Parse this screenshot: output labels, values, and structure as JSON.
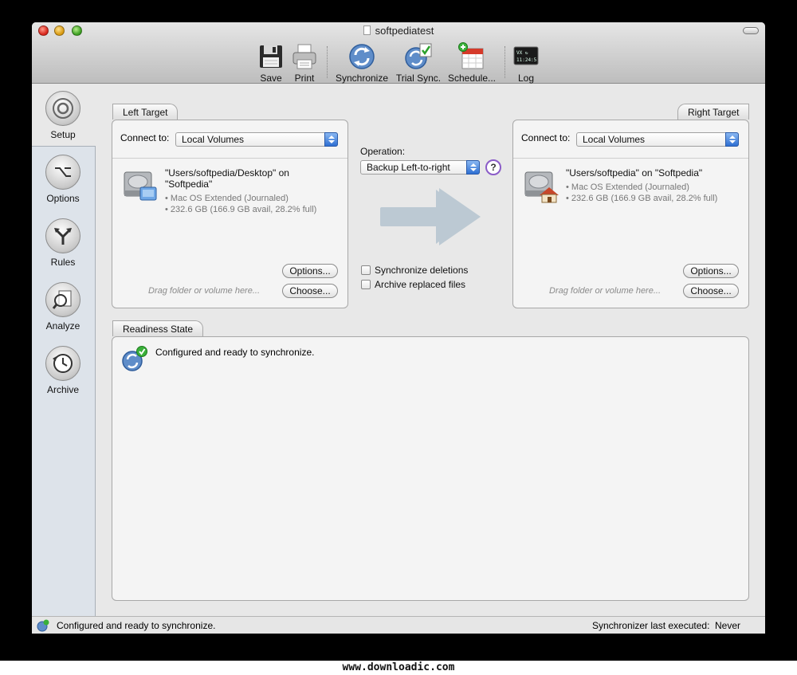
{
  "window": {
    "title": "softpediatest"
  },
  "toolbar": {
    "items": [
      {
        "label": "Save",
        "icon": "floppy-disk-icon"
      },
      {
        "label": "Print",
        "icon": "printer-icon"
      },
      {
        "label": "Synchronize",
        "icon": "sync-icon"
      },
      {
        "label": "Trial Sync.",
        "icon": "trial-sync-icon"
      },
      {
        "label": "Schedule...",
        "icon": "calendar-icon"
      },
      {
        "label": "Log",
        "icon": "terminal-icon"
      }
    ],
    "log_screen_text": "VX ↻\n11:24:5"
  },
  "sidebar": {
    "items": [
      {
        "label": "Setup",
        "icon": "setup-icon",
        "selected": true
      },
      {
        "label": "Options",
        "icon": "option-key-icon"
      },
      {
        "label": "Rules",
        "icon": "fork-icon"
      },
      {
        "label": "Analyze",
        "icon": "magnifier-icon"
      },
      {
        "label": "Archive",
        "icon": "clock-icon"
      }
    ]
  },
  "left_target": {
    "tab": "Left Target",
    "connect_label": "Connect to:",
    "connect_value": "Local Volumes",
    "volume_name": "\"Users/softpedia/Desktop\" on \"Softpedia\"",
    "format": "• Mac OS Extended (Journaled)",
    "capacity": "• 232.6 GB (166.9 GB avail, 28.2% full)",
    "options_button": "Options...",
    "choose_button": "Choose...",
    "hint": "Drag folder or volume here..."
  },
  "right_target": {
    "tab": "Right Target",
    "connect_label": "Connect to:",
    "connect_value": "Local Volumes",
    "volume_name": "\"Users/softpedia\" on \"Softpedia\"",
    "format": "• Mac OS Extended (Journaled)",
    "capacity": "• 232.6 GB (166.9 GB avail, 28.2% full)",
    "options_button": "Options...",
    "choose_button": "Choose...",
    "hint": "Drag folder or volume here..."
  },
  "operation": {
    "label": "Operation:",
    "value": "Backup Left-to-right",
    "help": "?",
    "sync_deletions": {
      "label": "Synchronize deletions",
      "checked": false
    },
    "archive_replaced": {
      "label": "Archive replaced files",
      "checked": false
    }
  },
  "readiness": {
    "tab": "Readiness State",
    "message": "Configured and ready to synchronize."
  },
  "status": {
    "message": "Configured and ready to synchronize.",
    "last_label": "Synchronizer last executed:",
    "last_value": "Never"
  },
  "footer": {
    "text": "www.downloadic.com"
  },
  "colors": {
    "accent_blue": "#2e6fd2",
    "arrow": "#bcc9d3",
    "check_green": "#3ab03a",
    "help_purple": "#8b5cc8"
  }
}
